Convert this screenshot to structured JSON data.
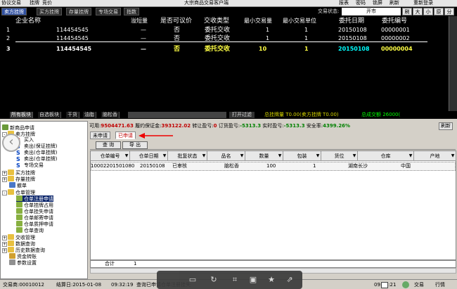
{
  "topbar": {
    "items": [
      "协议交易",
      "挂牌",
      "竞价",
      "大宗商品交易客户端"
    ],
    "right_items": [
      "报表",
      "密码",
      "锁屏",
      "刷新",
      "重新登录"
    ]
  },
  "tabs": {
    "items": [
      "卖方挂牌",
      "买方挂牌",
      "存量挂牌",
      "专场交易",
      "指数"
    ],
    "status_label": "交易状态:",
    "status_value": "开市",
    "buttons": [
      "刷",
      "大",
      "小",
      "原",
      "分"
    ]
  },
  "main_grid": {
    "headers": [
      "企业名称",
      "溢短量",
      "是否可议价",
      "交收类型",
      "最小交易量",
      "最小交易单位",
      "委托日期",
      "委托编号"
    ],
    "rows": [
      {
        "idx": "1",
        "name": "114454545",
        "overshort": "—",
        "negotiable": "否",
        "delivery": "委托交收",
        "min_qty": "1",
        "min_unit": "1",
        "date": "20150108",
        "no": "00000001"
      },
      {
        "idx": "2",
        "name": "114454545",
        "overshort": "—",
        "negotiable": "否",
        "delivery": "委托交收",
        "min_qty": "1",
        "min_unit": "1",
        "date": "20150108",
        "no": "00000002"
      },
      {
        "idx": "3",
        "name": "114454545",
        "overshort": "—",
        "negotiable": "否",
        "delivery": "委托交收",
        "min_qty": "10",
        "min_unit": "1",
        "date": "20150108",
        "no": "00000004"
      }
    ]
  },
  "bottom_tabs": {
    "items": [
      "所有板块",
      "自选板块",
      "干货",
      "油脂",
      "脑松香"
    ],
    "filter": "打开过滤",
    "ticker1": "总挂牌量 T0.00(卖方挂牌 T0.00)",
    "ticker2": "总成交额 26000("
  },
  "tree": {
    "items": [
      {
        "label": "新商品申请",
        "level": 0
      },
      {
        "label": "卖方挂牌",
        "level": 0
      },
      {
        "label": "买入",
        "level": 1
      },
      {
        "label": "卖出(保证挂牌)",
        "level": 1
      },
      {
        "label": "卖出(仓单挂牌)",
        "level": 1
      },
      {
        "label": "卖出(仓单挂牌)",
        "level": 1
      },
      {
        "label": "专场交易",
        "level": 1
      },
      {
        "label": "买方挂牌",
        "level": 0
      },
      {
        "label": "存量挂牌",
        "level": 0
      },
      {
        "label": "撤单",
        "level": 0
      },
      {
        "label": "仓单管理",
        "level": 0
      },
      {
        "label": "仓单注册申请",
        "level": 1
      },
      {
        "label": "仓单挂牌占用",
        "level": 1
      },
      {
        "label": "仓单挂失申请",
        "level": 1
      },
      {
        "label": "仓单邮寄申请",
        "level": 1
      },
      {
        "label": "仓单质押申请",
        "level": 1
      },
      {
        "label": "仓单查询",
        "level": 1
      },
      {
        "label": "交收管理",
        "level": 0
      },
      {
        "label": "数据查询",
        "level": 0
      },
      {
        "label": "历史数据查询",
        "level": 0
      },
      {
        "label": "资金转账",
        "level": 0
      },
      {
        "label": "参数设置",
        "level": 0
      }
    ]
  },
  "info": {
    "available_label": "可用:",
    "available_value": "9504471.63",
    "margin_label": "履约保证金:",
    "margin_value": "393122.02",
    "transfer_label": "转让盈亏:",
    "transfer_value": "0",
    "order_label": "订货盈亏:",
    "order_value": "-5313.3",
    "realtime_label": "实时盈亏:",
    "realtime_value": "-5313.3",
    "safety_label": "安全率:",
    "safety_value": "4399.26%",
    "refresh": "刷新"
  },
  "subtabs": [
    "未申请",
    "已申请"
  ],
  "buttons": {
    "query": "查 询",
    "export": "导 出"
  },
  "table": {
    "headers": [
      "仓单编号",
      "仓单日期",
      "批复状态",
      "品名",
      "数量",
      "包装",
      "货位",
      "仓库",
      "产地"
    ],
    "row": [
      "10002201501080",
      "20150108",
      "已审核",
      "脑松香",
      "100",
      "",
      "1",
      "湖南长沙",
      "中国"
    ],
    "total_label": "合计",
    "total_value": "1"
  },
  "statusbar": {
    "trader": "交易商:00010012",
    "settle": "结算日:2015-01-08",
    "time1": "09:32:19",
    "message": "查询已申请仓单注册挂失",
    "time2": "09:32:21",
    "trade": "交易",
    "market": "行情"
  },
  "toolbar_icons": [
    "screen-icon",
    "rotate-icon",
    "crop-icon",
    "save-icon",
    "star-icon",
    "share-icon"
  ],
  "colors": {
    "accent_red": "#c00000",
    "tab_active": "#3050a0",
    "grid_bg": "#000000",
    "highlight_yellow": "#ffff44",
    "highlight_cyan": "#00ffff"
  }
}
